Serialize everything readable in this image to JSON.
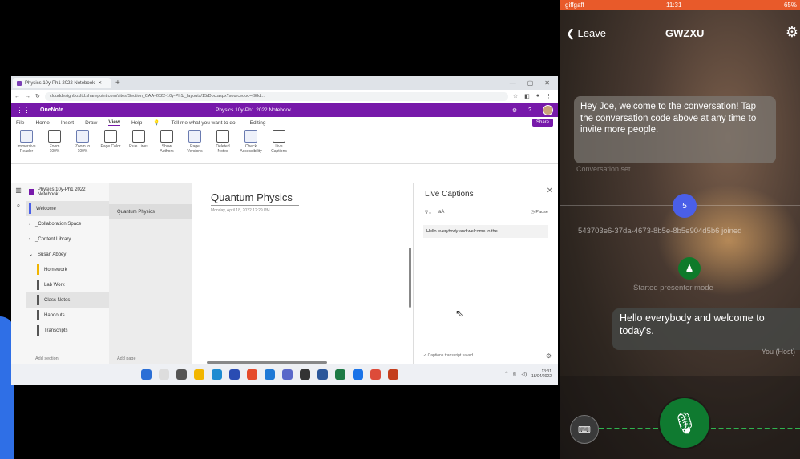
{
  "browser": {
    "tab_title": "Physics 10y-Ph1 2022 Notebook",
    "address": "clouddesignboxltd.sharepoint.com/sites/Section_CAA-2022-10y-Ph1/_layouts/15/Doc.aspx?sourcedoc={98d..."
  },
  "onenote": {
    "app_name": "OneNote",
    "notebook_title": "Physics 10y-Ph1 2022 Notebook",
    "menus": [
      "File",
      "Home",
      "Insert",
      "Draw",
      "View",
      "Help"
    ],
    "active_menu": "View",
    "tell_me": "Tell me what you want to do",
    "editing": "Editing",
    "share": "Share",
    "ribbon": [
      "Immersive Reader",
      "Zoom 100%",
      "Zoom to 100%",
      "Page Color",
      "Rule Lines",
      "Show Authors",
      "Page Versions",
      "Deleted Notes",
      "Check Accessibility",
      "Live Captions"
    ],
    "notebook_header": "Physics 10y-Ph1 2022 Notebook",
    "sections": [
      {
        "label": "Welcome",
        "level": 0
      },
      {
        "label": "_Collaboration Space",
        "level": 0
      },
      {
        "label": "_Content Library",
        "level": 0
      },
      {
        "label": "Susan Abbey",
        "level": 0
      },
      {
        "label": "Homework",
        "level": 1
      },
      {
        "label": "Lab Work",
        "level": 1
      },
      {
        "label": "Class Notes",
        "level": 1
      },
      {
        "label": "Handouts",
        "level": 1
      },
      {
        "label": "Transcripts",
        "level": 1
      }
    ],
    "add_section": "Add section",
    "page_item": "Quantum Physics",
    "add_page": "Add page",
    "page_title": "Quantum Physics",
    "page_date": "Monday, April 18, 2022   12:29 PM"
  },
  "captions": {
    "title": "Live Captions",
    "pause": "Pause",
    "text": "Hello everybody and welcome to the.",
    "saved": "Captions transcript saved"
  },
  "taskbar": {
    "time": "13:31",
    "date": "18/04/2022"
  },
  "phone": {
    "carrier": "giffgaff",
    "time": "11:31",
    "battery": "65%",
    "leave": "Leave",
    "code": "GWZXU",
    "welcome": "Hey Joe, welcome to the conversation! Tap the conversation code above at any time to invite more people.",
    "conv_set": "Conversation set",
    "badge": "5",
    "joined": "543703e6-37da-4673-8b5e-8b5e904d5b6 joined",
    "presenter": "Started presenter mode",
    "message": "Hello everybody and welcome to today's.",
    "host": "You (Host)"
  }
}
